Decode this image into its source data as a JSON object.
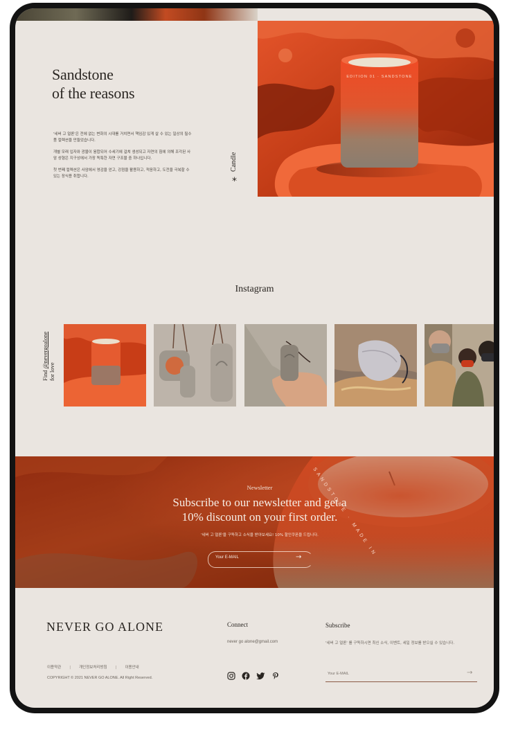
{
  "hero": {
    "title_line1": "Sandstone",
    "title_line2": "of the reasons",
    "paragraphs": [
      "'네버 고 얼론'은 전에 없는 변화의 시대를 거치면서 책임감 있게 살 수 있는 일상의 필수품 컬렉션을 만들었습니다.",
      "개별 모래 입자와 광물이 융합되어 수세기에 걸쳐 생성되고 자연의 힘에 의해 조각된 사암 성형은 지구상에서 가장 독특한 자연 구조물 중 하나입니다.",
      "첫 번째 컬렉션은 사암에서 영감을 얻고, 강점을 활용하고, 적응하고, 도전을 극복할 수 있는 장식용 취합니다."
    ],
    "candle_label": "Candle",
    "asterisk": "*",
    "candle_print": "EDITION 01 · SANDSTONE"
  },
  "instagram": {
    "title": "Instagram",
    "find_prefix": "Find ",
    "handle": "@nevergoalone",
    "find_suffix": "for love"
  },
  "newsletter": {
    "kicker": "Newsletter",
    "headline_line1": "Subscribe to our newsletter and get a",
    "headline_line2": "10% discount on your first order.",
    "subtext": "'네버 고 얼론'을 구독하고 소식을 받아보세요! 10% 할인쿠폰을 드립니다.",
    "input_placeholder": "Your E-MAIL",
    "arrow": "→",
    "candle_print": "SANDSTONE · MADE IN"
  },
  "footer": {
    "brand": "NEVER GO ALONE",
    "links": [
      "이용약관",
      "개인정보처리방침",
      "이용안내"
    ],
    "separator": "|",
    "copyright": "COPYRIGHT © 2021 NEVER GO ALONE. All Right Reserved.",
    "connect_title": "Connect",
    "connect_email": "never go alone@gmail.com",
    "social_icons": [
      "instagram-icon",
      "facebook-icon",
      "twitter-icon",
      "pinterest-icon"
    ],
    "subscribe_title": "Subscribe",
    "subscribe_text": "'네버 고 얼론' 를 구독하시면 최신 소식, 이벤트, 세일 정보를 받으실 수 있습니다.",
    "subscribe_placeholder": "Your E-MAIL",
    "subscribe_arrow": "→"
  },
  "colors": {
    "background": "#eae5e0",
    "accent": "#c9401a",
    "text": "#2a2622",
    "frame": "#131313"
  }
}
